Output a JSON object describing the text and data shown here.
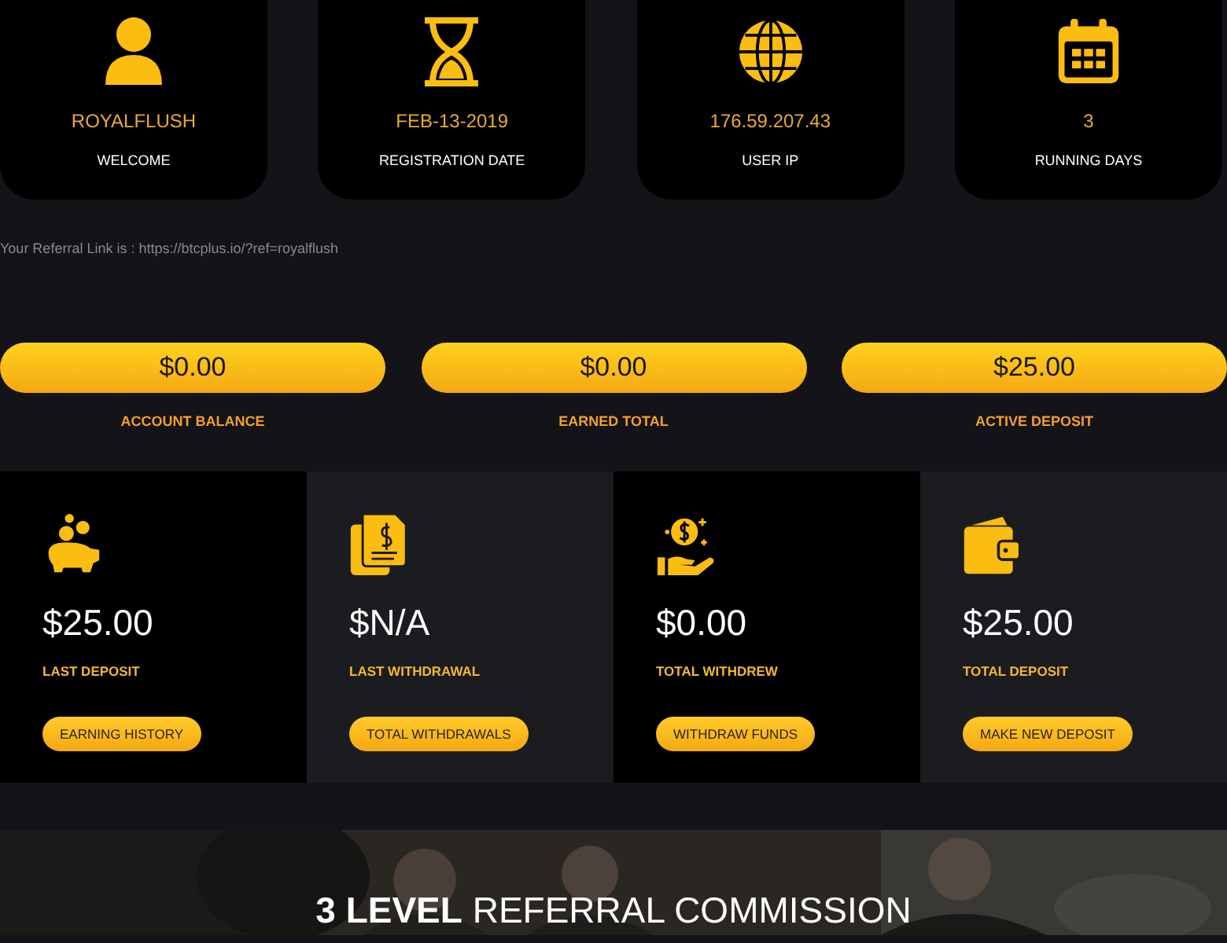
{
  "info_cards": [
    {
      "value": "ROYALFLUSH",
      "label": "WELCOME"
    },
    {
      "value": "FEB-13-2019",
      "label": "REGISTRATION DATE"
    },
    {
      "value": "176.59.207.43",
      "label": "USER IP"
    },
    {
      "value": "3",
      "label": "RUNNING DAYS"
    }
  ],
  "referral_link": "Your Referral Link is : https://btcplus.io/?ref=royalflush",
  "balances": [
    {
      "amount": "$0.00",
      "label": "ACCOUNT BALANCE"
    },
    {
      "amount": "$0.00",
      "label": "EARNED TOTAL"
    },
    {
      "amount": "$25.00",
      "label": "ACTIVE DEPOSIT"
    }
  ],
  "stats": [
    {
      "amount": "$25.00",
      "label": "LAST DEPOSIT",
      "button": "EARNING HISTORY"
    },
    {
      "amount": "$N/A",
      "label": "LAST WITHDRAWAL",
      "button": "TOTAL WITHDRAWALS"
    },
    {
      "amount": "$0.00",
      "label": "TOTAL WITHDREW",
      "button": "WITHDRAW FUNDS"
    },
    {
      "amount": "$25.00",
      "label": "TOTAL DEPOSIT",
      "button": "MAKE NEW DEPOSIT"
    }
  ],
  "banner": {
    "kind": "picture",
    "title": "**3 LEVEL** REFERRAL COMMISSION"
  }
}
